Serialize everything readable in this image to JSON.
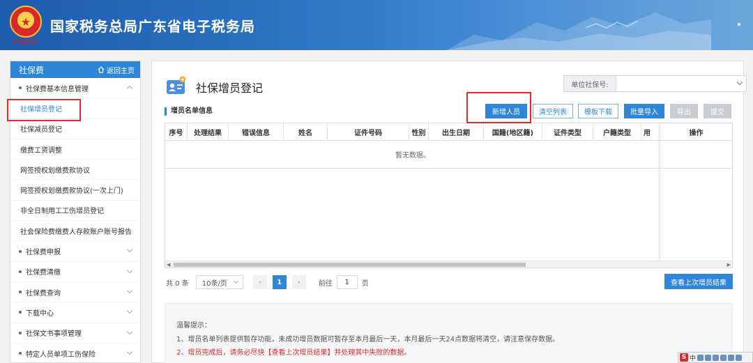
{
  "header": {
    "title": "国家税务总局广东省电子税务局",
    "emblem_text": "中國政府"
  },
  "sidebar": {
    "head_title": "社保费",
    "home_label": "返回主页",
    "items": [
      {
        "label": "社保费基本信息管理"
      },
      {
        "label": "社保增员登记"
      },
      {
        "label": "社保减员登记"
      },
      {
        "label": "缴费工资调整"
      },
      {
        "label": "网签授权划缴费款协议"
      },
      {
        "label": "网签授权划缴费款协议(一次上门)"
      },
      {
        "label": "非全日制用工工伤增员登记"
      },
      {
        "label": "社会保险费缴费人存款账户账号报告"
      },
      {
        "label": "社保费申报"
      },
      {
        "label": "社保费清缴"
      },
      {
        "label": "社保费查询"
      },
      {
        "label": "下载中心"
      },
      {
        "label": "社保文书事项管理"
      },
      {
        "label": "特定人员单项工伤保险"
      }
    ]
  },
  "main": {
    "title": "社保增员登记",
    "unit_label": "单位社保号:",
    "section_title": "增员名单信息",
    "buttons": {
      "add": "新增人员",
      "clear": "清空列表",
      "template": "模板下载",
      "import": "批量导入",
      "export": "导出",
      "submit": "提交"
    },
    "table": {
      "columns": [
        "序号",
        "处理结果",
        "错误信息",
        "姓名",
        "证件号码",
        "性别",
        "出生日期",
        "国籍(地区籍)",
        "证件类型",
        "户籍类型",
        "用"
      ],
      "op_column": "操作",
      "empty_text": "暂无数据。"
    },
    "pager": {
      "total": "共 0 条",
      "page_size": "10条/页",
      "prev": "‹",
      "current": "1",
      "next": "›",
      "goto_label": "前往",
      "goto_value": "1",
      "page_unit": "页"
    },
    "last_result_button": "查看上次增员结果",
    "tips": {
      "heading": "温馨提示：",
      "line1": "1、增员名单列表提供暂存功能，未成功增员数据可暂存至本月最后一天，本月最后一天24点数据将清空，请注意保存数据。",
      "line2": "2、增员完成后，请务必尽快【查看上次增员结果】并处理其中失败的数据。"
    }
  },
  "tray": {
    "ime": "S",
    "lang": "中"
  },
  "colors": {
    "primary": "#2f86d8",
    "highlight": "#e0292b",
    "header": "#1d5cae"
  }
}
